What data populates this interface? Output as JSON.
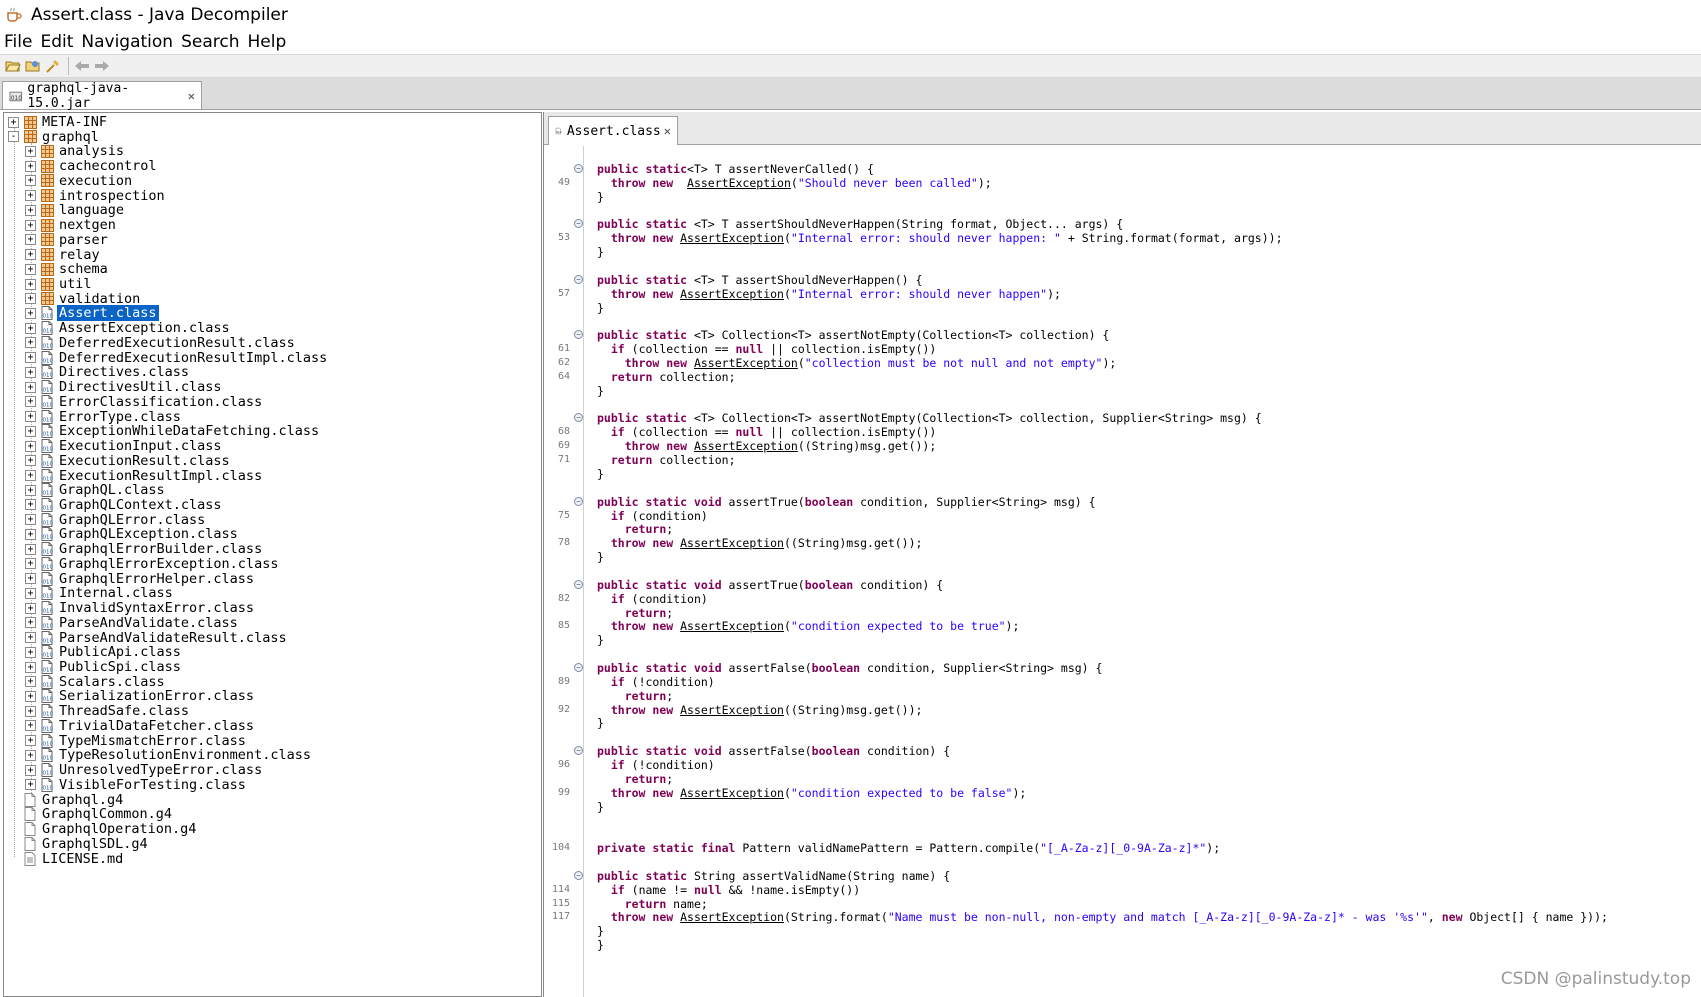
{
  "window": {
    "title": "Assert.class - Java Decompiler"
  },
  "menu": [
    "File",
    "Edit",
    "Navigation",
    "Search",
    "Help"
  ],
  "toolbar": {
    "icons": [
      "open-file-icon",
      "open-type-icon",
      "search-icon",
      "back-icon",
      "forward-icon"
    ]
  },
  "file_tab": {
    "label": "graphql-java-15.0.jar"
  },
  "editor_tab": {
    "label": "Assert.class"
  },
  "colors": {
    "selection": "#0a64c8",
    "keyword": "#7f0055",
    "string": "#2a00ff",
    "package": "#c86400"
  },
  "tree": [
    {
      "label": "META-INF",
      "type": "package",
      "level": 0,
      "expander": "+"
    },
    {
      "label": "graphql",
      "type": "package",
      "level": 0,
      "expander": "-"
    },
    {
      "label": "analysis",
      "type": "package",
      "level": 1,
      "expander": "+"
    },
    {
      "label": "cachecontrol",
      "type": "package",
      "level": 1,
      "expander": "+"
    },
    {
      "label": "execution",
      "type": "package",
      "level": 1,
      "expander": "+"
    },
    {
      "label": "introspection",
      "type": "package",
      "level": 1,
      "expander": "+"
    },
    {
      "label": "language",
      "type": "package",
      "level": 1,
      "expander": "+"
    },
    {
      "label": "nextgen",
      "type": "package",
      "level": 1,
      "expander": "+"
    },
    {
      "label": "parser",
      "type": "package",
      "level": 1,
      "expander": "+"
    },
    {
      "label": "relay",
      "type": "package",
      "level": 1,
      "expander": "+"
    },
    {
      "label": "schema",
      "type": "package",
      "level": 1,
      "expander": "+"
    },
    {
      "label": "util",
      "type": "package",
      "level": 1,
      "expander": "+"
    },
    {
      "label": "validation",
      "type": "package",
      "level": 1,
      "expander": "+"
    },
    {
      "label": "Assert.class",
      "type": "class",
      "level": 1,
      "expander": "+",
      "selected": true
    },
    {
      "label": "AssertException.class",
      "type": "class",
      "level": 1,
      "expander": "+"
    },
    {
      "label": "DeferredExecutionResult.class",
      "type": "class",
      "level": 1,
      "expander": "+"
    },
    {
      "label": "DeferredExecutionResultImpl.class",
      "type": "class",
      "level": 1,
      "expander": "+"
    },
    {
      "label": "Directives.class",
      "type": "class",
      "level": 1,
      "expander": "+"
    },
    {
      "label": "DirectivesUtil.class",
      "type": "class",
      "level": 1,
      "expander": "+"
    },
    {
      "label": "ErrorClassification.class",
      "type": "class",
      "level": 1,
      "expander": "+"
    },
    {
      "label": "ErrorType.class",
      "type": "class",
      "level": 1,
      "expander": "+"
    },
    {
      "label": "ExceptionWhileDataFetching.class",
      "type": "class",
      "level": 1,
      "expander": "+"
    },
    {
      "label": "ExecutionInput.class",
      "type": "class",
      "level": 1,
      "expander": "+"
    },
    {
      "label": "ExecutionResult.class",
      "type": "class",
      "level": 1,
      "expander": "+"
    },
    {
      "label": "ExecutionResultImpl.class",
      "type": "class",
      "level": 1,
      "expander": "+"
    },
    {
      "label": "GraphQL.class",
      "type": "class",
      "level": 1,
      "expander": "+"
    },
    {
      "label": "GraphQLContext.class",
      "type": "class",
      "level": 1,
      "expander": "+"
    },
    {
      "label": "GraphQLError.class",
      "type": "class",
      "level": 1,
      "expander": "+"
    },
    {
      "label": "GraphQLException.class",
      "type": "class",
      "level": 1,
      "expander": "+"
    },
    {
      "label": "GraphqlErrorBuilder.class",
      "type": "class",
      "level": 1,
      "expander": "+"
    },
    {
      "label": "GraphqlErrorException.class",
      "type": "class",
      "level": 1,
      "expander": "+"
    },
    {
      "label": "GraphqlErrorHelper.class",
      "type": "class",
      "level": 1,
      "expander": "+"
    },
    {
      "label": "Internal.class",
      "type": "class",
      "level": 1,
      "expander": "+"
    },
    {
      "label": "InvalidSyntaxError.class",
      "type": "class",
      "level": 1,
      "expander": "+"
    },
    {
      "label": "ParseAndValidate.class",
      "type": "class",
      "level": 1,
      "expander": "+"
    },
    {
      "label": "ParseAndValidateResult.class",
      "type": "class",
      "level": 1,
      "expander": "+"
    },
    {
      "label": "PublicApi.class",
      "type": "class",
      "level": 1,
      "expander": "+"
    },
    {
      "label": "PublicSpi.class",
      "type": "class",
      "level": 1,
      "expander": "+"
    },
    {
      "label": "Scalars.class",
      "type": "class",
      "level": 1,
      "expander": "+"
    },
    {
      "label": "SerializationError.class",
      "type": "class",
      "level": 1,
      "expander": "+"
    },
    {
      "label": "ThreadSafe.class",
      "type": "class",
      "level": 1,
      "expander": "+"
    },
    {
      "label": "TrivialDataFetcher.class",
      "type": "class",
      "level": 1,
      "expander": "+"
    },
    {
      "label": "TypeMismatchError.class",
      "type": "class",
      "level": 1,
      "expander": "+"
    },
    {
      "label": "TypeResolutionEnvironment.class",
      "type": "class",
      "level": 1,
      "expander": "+"
    },
    {
      "label": "UnresolvedTypeError.class",
      "type": "class",
      "level": 1,
      "expander": "+"
    },
    {
      "label": "VisibleForTesting.class",
      "type": "class",
      "level": 1,
      "expander": "+"
    },
    {
      "label": "Graphql.g4",
      "type": "file",
      "level": 0,
      "expander": ""
    },
    {
      "label": "GraphqlCommon.g4",
      "type": "file",
      "level": 0,
      "expander": ""
    },
    {
      "label": "GraphqlOperation.g4",
      "type": "file",
      "level": 0,
      "expander": ""
    },
    {
      "label": "GraphqlSDL.g4",
      "type": "file",
      "level": 0,
      "expander": ""
    },
    {
      "label": "LICENSE.md",
      "type": "textfile",
      "level": 0,
      "expander": ""
    }
  ],
  "code_lines": [
    {
      "ln": "",
      "fold": true,
      "spans": [
        [
          "kw",
          "public static"
        ],
        [
          "",
          "<T> T assertNeverCalled() {"
        ]
      ]
    },
    {
      "ln": "49",
      "spans": [
        [
          "",
          "  "
        ],
        [
          "kw",
          "throw new"
        ],
        [
          "",
          "  "
        ],
        [
          "lnk",
          "AssertException"
        ],
        [
          "",
          "("
        ],
        [
          "str",
          "\"Should never been called\""
        ],
        [
          "",
          ");"
        ]
      ]
    },
    {
      "ln": "",
      "spans": [
        [
          "",
          "}"
        ]
      ]
    },
    {
      "ln": "",
      "spans": []
    },
    {
      "ln": "",
      "fold": true,
      "spans": [
        [
          "kw",
          "public static"
        ],
        [
          "",
          " <T> T assertShouldNeverHappen(String format, Object... args) {"
        ]
      ]
    },
    {
      "ln": "53",
      "spans": [
        [
          "",
          "  "
        ],
        [
          "kw",
          "throw new"
        ],
        [
          "",
          " "
        ],
        [
          "lnk",
          "AssertException"
        ],
        [
          "",
          "("
        ],
        [
          "str",
          "\"Internal error: should never happen: \""
        ],
        [
          "",
          " + String.format(format, args));"
        ]
      ]
    },
    {
      "ln": "",
      "spans": [
        [
          "",
          "}"
        ]
      ]
    },
    {
      "ln": "",
      "spans": []
    },
    {
      "ln": "",
      "fold": true,
      "spans": [
        [
          "kw",
          "public static"
        ],
        [
          "",
          " <T> T assertShouldNeverHappen() {"
        ]
      ]
    },
    {
      "ln": "57",
      "spans": [
        [
          "",
          "  "
        ],
        [
          "kw",
          "throw new"
        ],
        [
          "",
          " "
        ],
        [
          "lnk",
          "AssertException"
        ],
        [
          "",
          "("
        ],
        [
          "str",
          "\"Internal error: should never happen\""
        ],
        [
          "",
          ");"
        ]
      ]
    },
    {
      "ln": "",
      "spans": [
        [
          "",
          "}"
        ]
      ]
    },
    {
      "ln": "",
      "spans": []
    },
    {
      "ln": "",
      "fold": true,
      "spans": [
        [
          "kw",
          "public static"
        ],
        [
          "",
          " <T> Collection<T> assertNotEmpty(Collection<T> collection) {"
        ]
      ]
    },
    {
      "ln": "61",
      "spans": [
        [
          "",
          "  "
        ],
        [
          "kw",
          "if"
        ],
        [
          "",
          " (collection == "
        ],
        [
          "kw",
          "null"
        ],
        [
          "",
          " || collection.isEmpty())"
        ]
      ]
    },
    {
      "ln": "62",
      "spans": [
        [
          "",
          "    "
        ],
        [
          "kw",
          "throw new"
        ],
        [
          "",
          " "
        ],
        [
          "lnk",
          "AssertException"
        ],
        [
          "",
          "("
        ],
        [
          "str",
          "\"collection must be not null and not empty\""
        ],
        [
          "",
          ");"
        ]
      ]
    },
    {
      "ln": "64",
      "spans": [
        [
          "",
          "  "
        ],
        [
          "kw",
          "return"
        ],
        [
          "",
          " collection;"
        ]
      ]
    },
    {
      "ln": "",
      "spans": [
        [
          "",
          "}"
        ]
      ]
    },
    {
      "ln": "",
      "spans": []
    },
    {
      "ln": "",
      "fold": true,
      "spans": [
        [
          "kw",
          "public static"
        ],
        [
          "",
          " <T> Collection<T> assertNotEmpty(Collection<T> collection, Supplier<String> msg) {"
        ]
      ]
    },
    {
      "ln": "68",
      "spans": [
        [
          "",
          "  "
        ],
        [
          "kw",
          "if"
        ],
        [
          "",
          " (collection == "
        ],
        [
          "kw",
          "null"
        ],
        [
          "",
          " || collection.isEmpty())"
        ]
      ]
    },
    {
      "ln": "69",
      "spans": [
        [
          "",
          "    "
        ],
        [
          "kw",
          "throw new"
        ],
        [
          "",
          " "
        ],
        [
          "lnk",
          "AssertException"
        ],
        [
          "",
          "((String)msg.get());"
        ]
      ]
    },
    {
      "ln": "71",
      "spans": [
        [
          "",
          "  "
        ],
        [
          "kw",
          "return"
        ],
        [
          "",
          " collection;"
        ]
      ]
    },
    {
      "ln": "",
      "spans": [
        [
          "",
          "}"
        ]
      ]
    },
    {
      "ln": "",
      "spans": []
    },
    {
      "ln": "",
      "fold": true,
      "spans": [
        [
          "kw",
          "public static void"
        ],
        [
          "",
          " assertTrue("
        ],
        [
          "kw",
          "boolean"
        ],
        [
          "",
          " condition, Supplier<String> msg) {"
        ]
      ]
    },
    {
      "ln": "75",
      "spans": [
        [
          "",
          "  "
        ],
        [
          "kw",
          "if"
        ],
        [
          "",
          " (condition)"
        ]
      ]
    },
    {
      "ln": "",
      "spans": [
        [
          "",
          "    "
        ],
        [
          "kw",
          "return"
        ],
        [
          "",
          ";"
        ]
      ]
    },
    {
      "ln": "78",
      "spans": [
        [
          "",
          "  "
        ],
        [
          "kw",
          "throw new"
        ],
        [
          "",
          " "
        ],
        [
          "lnk",
          "AssertException"
        ],
        [
          "",
          "((String)msg.get());"
        ]
      ]
    },
    {
      "ln": "",
      "spans": [
        [
          "",
          "}"
        ]
      ]
    },
    {
      "ln": "",
      "spans": []
    },
    {
      "ln": "",
      "fold": true,
      "spans": [
        [
          "kw",
          "public static void"
        ],
        [
          "",
          " assertTrue("
        ],
        [
          "kw",
          "boolean"
        ],
        [
          "",
          " condition) {"
        ]
      ]
    },
    {
      "ln": "82",
      "spans": [
        [
          "",
          "  "
        ],
        [
          "kw",
          "if"
        ],
        [
          "",
          " (condition)"
        ]
      ]
    },
    {
      "ln": "",
      "spans": [
        [
          "",
          "    "
        ],
        [
          "kw",
          "return"
        ],
        [
          "",
          ";"
        ]
      ]
    },
    {
      "ln": "85",
      "spans": [
        [
          "",
          "  "
        ],
        [
          "kw",
          "throw new"
        ],
        [
          "",
          " "
        ],
        [
          "lnk",
          "AssertException"
        ],
        [
          "",
          "("
        ],
        [
          "str",
          "\"condition expected to be true\""
        ],
        [
          "",
          ");"
        ]
      ]
    },
    {
      "ln": "",
      "spans": [
        [
          "",
          "}"
        ]
      ]
    },
    {
      "ln": "",
      "spans": []
    },
    {
      "ln": "",
      "fold": true,
      "spans": [
        [
          "kw",
          "public static void"
        ],
        [
          "",
          " assertFalse("
        ],
        [
          "kw",
          "boolean"
        ],
        [
          "",
          " condition, Supplier<String> msg) {"
        ]
      ]
    },
    {
      "ln": "89",
      "spans": [
        [
          "",
          "  "
        ],
        [
          "kw",
          "if"
        ],
        [
          "",
          " (!condition)"
        ]
      ]
    },
    {
      "ln": "",
      "spans": [
        [
          "",
          "    "
        ],
        [
          "kw",
          "return"
        ],
        [
          "",
          ";"
        ]
      ]
    },
    {
      "ln": "92",
      "spans": [
        [
          "",
          "  "
        ],
        [
          "kw",
          "throw new"
        ],
        [
          "",
          " "
        ],
        [
          "lnk",
          "AssertException"
        ],
        [
          "",
          "((String)msg.get());"
        ]
      ]
    },
    {
      "ln": "",
      "spans": [
        [
          "",
          "}"
        ]
      ]
    },
    {
      "ln": "",
      "spans": []
    },
    {
      "ln": "",
      "fold": true,
      "spans": [
        [
          "kw",
          "public static void"
        ],
        [
          "",
          " assertFalse("
        ],
        [
          "kw",
          "boolean"
        ],
        [
          "",
          " condition) {"
        ]
      ]
    },
    {
      "ln": "96",
      "spans": [
        [
          "",
          "  "
        ],
        [
          "kw",
          "if"
        ],
        [
          "",
          " (!condition)"
        ]
      ]
    },
    {
      "ln": "",
      "spans": [
        [
          "",
          "    "
        ],
        [
          "kw",
          "return"
        ],
        [
          "",
          ";"
        ]
      ]
    },
    {
      "ln": "99",
      "spans": [
        [
          "",
          "  "
        ],
        [
          "kw",
          "throw new"
        ],
        [
          "",
          " "
        ],
        [
          "lnk",
          "AssertException"
        ],
        [
          "",
          "("
        ],
        [
          "str",
          "\"condition expected to be false\""
        ],
        [
          "",
          ");"
        ]
      ]
    },
    {
      "ln": "",
      "spans": [
        [
          "",
          "}"
        ]
      ]
    },
    {
      "ln": "",
      "spans": []
    },
    {
      "ln": "",
      "spans": []
    },
    {
      "ln": "104",
      "spans": [
        [
          "kw",
          "private static final"
        ],
        [
          "",
          " Pattern validNamePattern = Pattern.compile("
        ],
        [
          "str",
          "\"[_A-Za-z][_0-9A-Za-z]*\""
        ],
        [
          "",
          ");"
        ]
      ]
    },
    {
      "ln": "",
      "spans": []
    },
    {
      "ln": "",
      "fold": true,
      "spans": [
        [
          "kw",
          "public static"
        ],
        [
          "",
          " String assertValidName(String name) {"
        ]
      ]
    },
    {
      "ln": "114",
      "spans": [
        [
          "",
          "  "
        ],
        [
          "kw",
          "if"
        ],
        [
          "",
          " (name != "
        ],
        [
          "kw",
          "null"
        ],
        [
          "",
          " && !name.isEmpty())"
        ]
      ]
    },
    {
      "ln": "115",
      "spans": [
        [
          "",
          "    "
        ],
        [
          "kw",
          "return"
        ],
        [
          "",
          " name;"
        ]
      ]
    },
    {
      "ln": "117",
      "spans": [
        [
          "",
          "  "
        ],
        [
          "kw",
          "throw new"
        ],
        [
          "",
          " "
        ],
        [
          "lnk",
          "AssertException"
        ],
        [
          "",
          "(String.format("
        ],
        [
          "str",
          "\"Name must be non-null, non-empty and match [_A-Za-z][_0-9A-Za-z]* - was '%s'\""
        ],
        [
          "",
          ", "
        ],
        [
          "kw",
          "new"
        ],
        [
          "",
          " Object[] { name }));"
        ]
      ]
    },
    {
      "ln": "",
      "spans": [
        [
          "",
          "}"
        ]
      ]
    },
    {
      "ln": "",
      "spans": [
        [
          "",
          "}"
        ]
      ]
    }
  ],
  "watermark": "CSDN @palinstudy.top"
}
